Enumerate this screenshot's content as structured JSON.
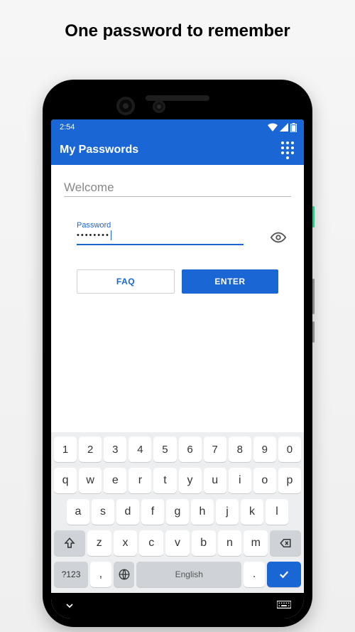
{
  "headline": "One password to remember",
  "status": {
    "time": "2:54"
  },
  "appbar": {
    "title": "My Passwords"
  },
  "login": {
    "welcome": "Welcome",
    "password_label": "Password",
    "password_value": "••••••••",
    "faq_label": "FAQ",
    "enter_label": "ENTER"
  },
  "keyboard": {
    "row_nums": [
      "1",
      "2",
      "3",
      "4",
      "5",
      "6",
      "7",
      "8",
      "9",
      "0"
    ],
    "row1": [
      "q",
      "w",
      "e",
      "r",
      "t",
      "y",
      "u",
      "i",
      "o",
      "p"
    ],
    "row2": [
      "a",
      "s",
      "d",
      "f",
      "g",
      "h",
      "j",
      "k",
      "l"
    ],
    "row3": [
      "z",
      "x",
      "c",
      "v",
      "b",
      "n",
      "m"
    ],
    "symkey": "?123",
    "comma": ",",
    "space_label": "English",
    "period": "."
  }
}
